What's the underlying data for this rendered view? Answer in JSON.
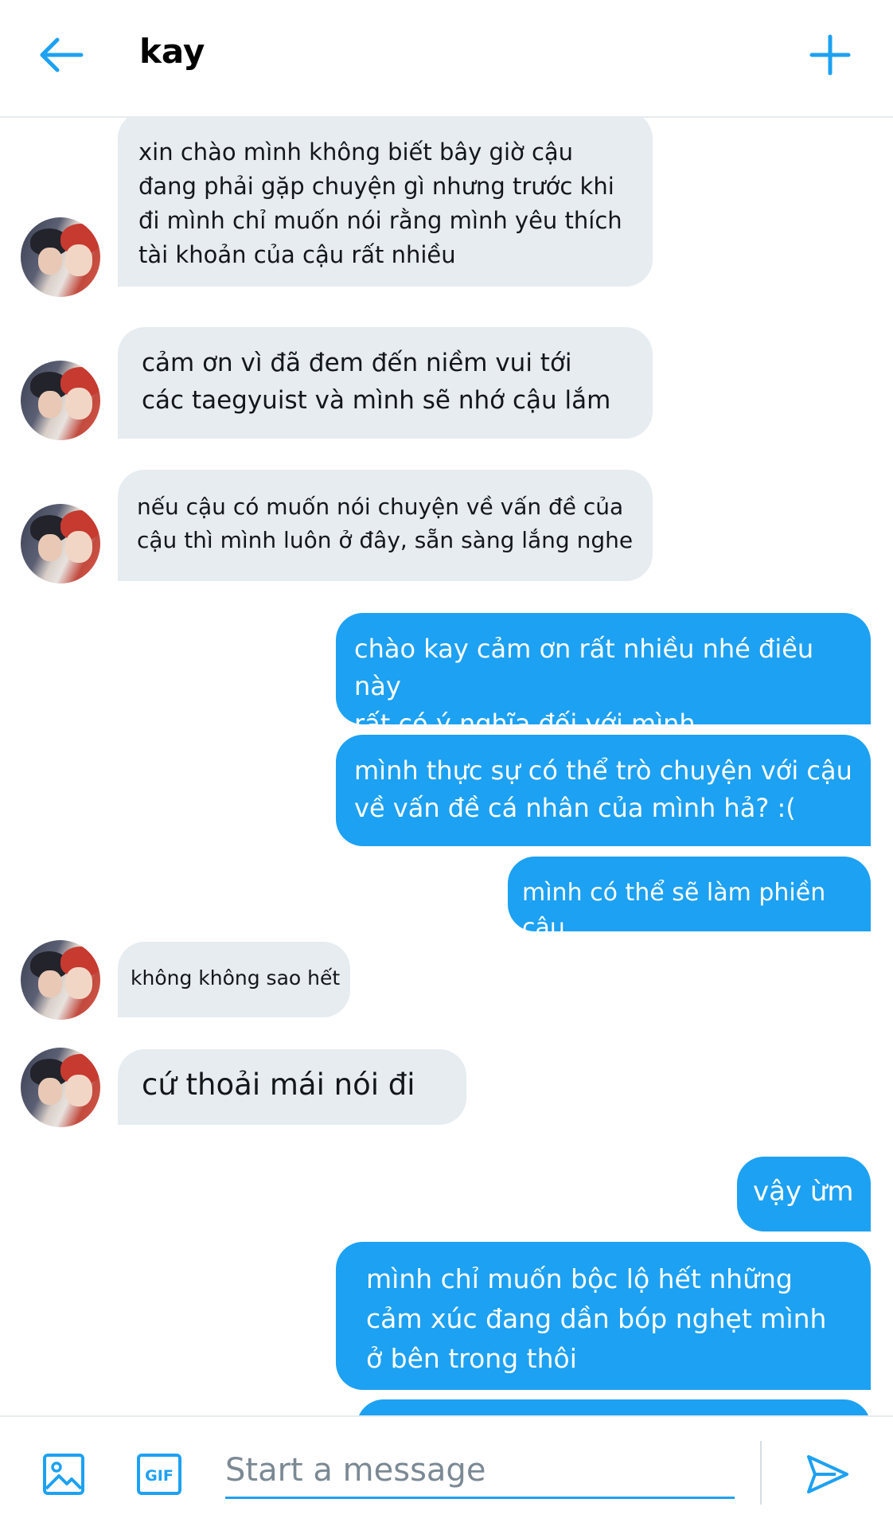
{
  "header": {
    "title": "kay"
  },
  "messages": [
    {
      "text": "xin chào mình không biết bây giờ cậu\nđang phải gặp chuyện gì nhưng trước khi\nđi mình chỉ muốn nói rằng mình yêu thích\ntài khoản của cậu rất nhiều"
    },
    {
      "text": "cảm ơn vì đã đem đến niềm vui tới\ncác taegyuist và mình sẽ nhớ cậu lắm"
    },
    {
      "text": "nếu cậu có muốn nói chuyện về vấn đề của\ncậu thì mình luôn ở đây, sẵn sàng lắng nghe"
    },
    {
      "text": "chào kay cảm ơn rất nhiều nhé điều này\nrất có ý nghĩa đối với mình"
    },
    {
      "text": "mình thực sự có thể trò chuyện với cậu\nvề vấn đề cá nhân của mình hả? :("
    },
    {
      "text": "mình có thể sẽ làm phiền cậu"
    },
    {
      "text": "không không sao hết"
    },
    {
      "text": "cứ thoải mái nói đi"
    },
    {
      "text": "vậy ừm"
    },
    {
      "text": "mình chỉ muốn bộc lộ hết những\ncảm xúc đang dần bóp nghẹt mình\nở bên trong thôi"
    }
  ],
  "composer": {
    "placeholder": "Start a message",
    "gif_label": "GIF"
  },
  "colors": {
    "accent": "#1da1f2",
    "incoming_bubble": "#e6ecf0"
  }
}
